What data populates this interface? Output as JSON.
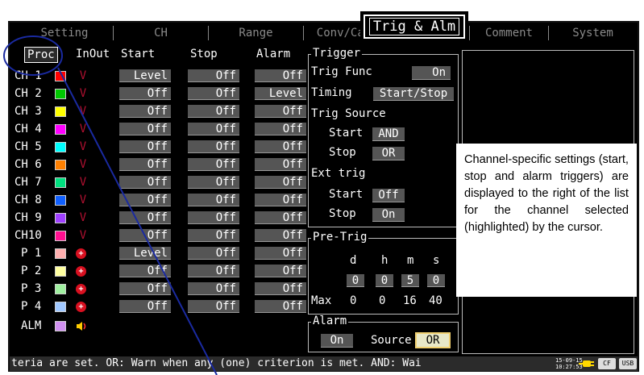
{
  "tabs": [
    {
      "label": "Setting",
      "active": false
    },
    {
      "label": "CH",
      "active": false
    },
    {
      "label": "Range",
      "active": false
    },
    {
      "label": "Conv/Cal",
      "active": false
    },
    {
      "label": "Trig & Alm",
      "active": true
    },
    {
      "label": "Comment",
      "active": false
    },
    {
      "label": "System",
      "active": false
    }
  ],
  "columns": {
    "proc": "Proc",
    "inout": "InOut",
    "start": "Start",
    "stop": "Stop",
    "alarm": "Alarm"
  },
  "channels": [
    {
      "name": "CH 1",
      "color": "#ff0000",
      "start": "Level",
      "stop": "Off",
      "alarm": "Off"
    },
    {
      "name": "CH 2",
      "color": "#00c800",
      "start": "Off",
      "stop": "Off",
      "alarm": "Level"
    },
    {
      "name": "CH 3",
      "color": "#ffff00",
      "start": "Off",
      "stop": "Off",
      "alarm": "Off"
    },
    {
      "name": "CH 4",
      "color": "#ff00ff",
      "start": "Off",
      "stop": "Off",
      "alarm": "Off"
    },
    {
      "name": "CH 5",
      "color": "#00ffff",
      "start": "Off",
      "stop": "Off",
      "alarm": "Off"
    },
    {
      "name": "CH 6",
      "color": "#ff8000",
      "start": "Off",
      "stop": "Off",
      "alarm": "Off"
    },
    {
      "name": "CH 7",
      "color": "#00e080",
      "start": "Off",
      "stop": "Off",
      "alarm": "Off"
    },
    {
      "name": "CH 8",
      "color": "#1060ff",
      "start": "Off",
      "stop": "Off",
      "alarm": "Off"
    },
    {
      "name": "CH 9",
      "color": "#a040ff",
      "start": "Off",
      "stop": "Off",
      "alarm": "Off"
    },
    {
      "name": "CH10",
      "color": "#ff1090",
      "start": "Off",
      "stop": "Off",
      "alarm": "Off"
    }
  ],
  "pulses": [
    {
      "name": "P 1",
      "color": "#ffb0b0",
      "start": "Level",
      "stop": "Off",
      "alarm": "Off"
    },
    {
      "name": "P 2",
      "color": "#ffffa0",
      "start": "Off",
      "stop": "Off",
      "alarm": "Off"
    },
    {
      "name": "P 3",
      "color": "#a0f0a0",
      "start": "Off",
      "stop": "Off",
      "alarm": "Off"
    },
    {
      "name": "P 4",
      "color": "#a0c8ff",
      "start": "Off",
      "stop": "Off",
      "alarm": "Off"
    }
  ],
  "alm": {
    "name": "ALM",
    "color": "#d090f0"
  },
  "trigger": {
    "title": "Trigger",
    "func_label": "Trig Func",
    "func_value": "On",
    "timing_label": "Timing",
    "timing_value": "Start/Stop",
    "source_label": "Trig Source",
    "start_label": "Start",
    "start_value": "AND",
    "stop_label": "Stop",
    "stop_value": "OR",
    "ext_label": "Ext trig",
    "ext_start_label": "Start",
    "ext_start_value": "Off",
    "ext_stop_label": "Stop",
    "ext_stop_value": "On"
  },
  "pretrig": {
    "title": "Pre-Trig",
    "units": [
      "d",
      "h",
      "m",
      "s"
    ],
    "values": [
      "0",
      "0",
      "5",
      "0"
    ],
    "max_label": "Max",
    "max_values": [
      "0",
      "0",
      "16",
      "40"
    ]
  },
  "alarm": {
    "title": "Alarm",
    "enable": "On",
    "source_label": "Source",
    "source_value": "OR"
  },
  "note": "Channel-specific settings (start, stop and alarm triggers) are displayed to the right of the list for the channel selected (highlighted) by the cursor.",
  "status": {
    "message": "teria are set. OR: Warn when any (one) criterion is met. AND: Wai",
    "date": "15-09-15",
    "time": "10:27:53",
    "cf": "CF",
    "usb": "USB"
  },
  "colors": {
    "callout": "#1a2aa0",
    "inout_mark": "#b01030"
  }
}
